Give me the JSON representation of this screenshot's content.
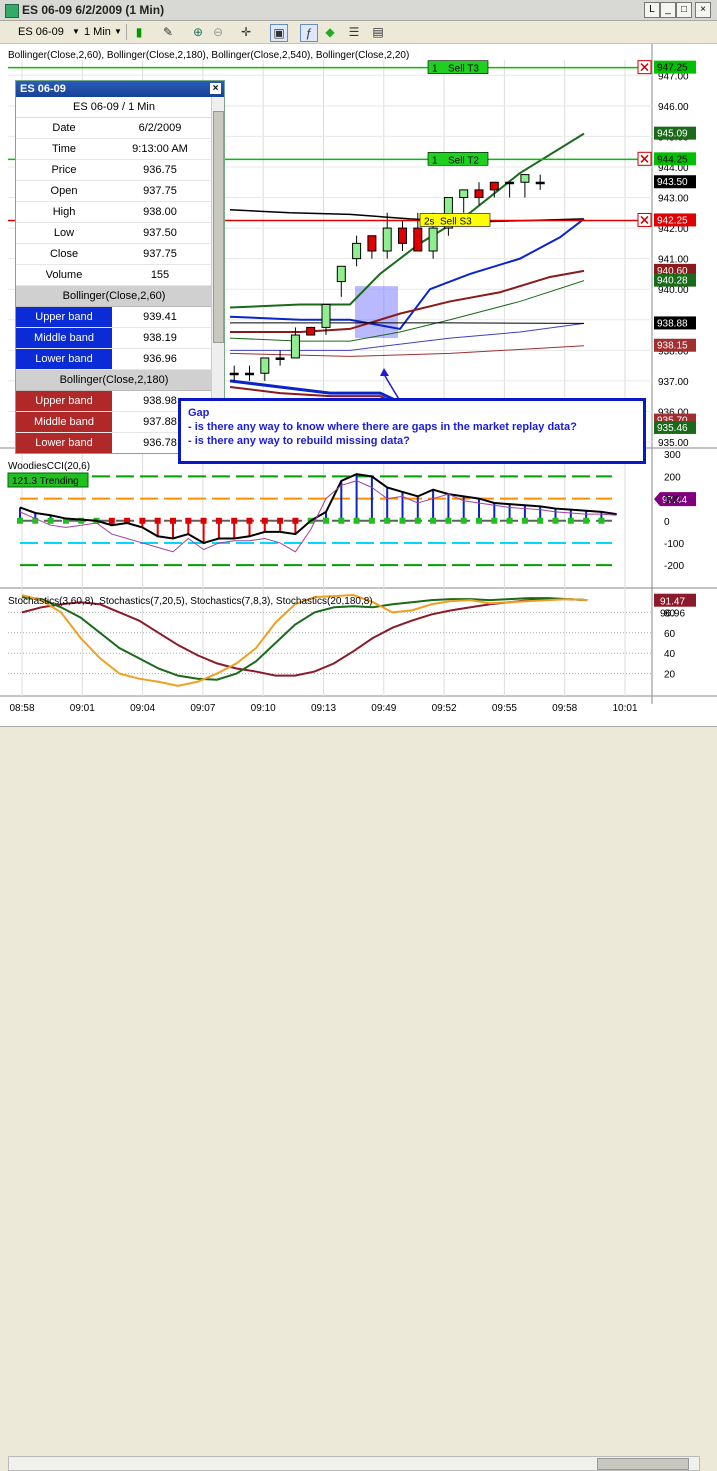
{
  "window": {
    "title": "ES 06-09  6/2/2009 (1 Min)",
    "btn_l": "L",
    "btn_min": "_",
    "btn_max": "□",
    "btn_close": "×"
  },
  "toolbar": {
    "instrument": "ES 06-09",
    "interval": "1 Min"
  },
  "indicator_labels": {
    "bollinger": "Bollinger(Close,2,60), Bollinger(Close,2,180), Bollinger(Close,2,540), Bollinger(Close,2,20)",
    "cci": "WoodiesCCI(20,6)",
    "cci_trend": "121.3 Trending",
    "stochastics": "Stochastics(3,60,8), Stochastics(7,20,5), Stochastics(7,8,3), Stochastics(20,180,8)"
  },
  "databox": {
    "title": "ES 06-09",
    "subtitle": "ES 06-09 / 1 Min",
    "rows": [
      {
        "k": "Date",
        "v": "6/2/2009"
      },
      {
        "k": "Time",
        "v": "9:13:00 AM"
      },
      {
        "k": "Price",
        "v": "936.75"
      },
      {
        "k": "Open",
        "v": "937.75"
      },
      {
        "k": "High",
        "v": "938.00"
      },
      {
        "k": "Low",
        "v": "937.50"
      },
      {
        "k": "Close",
        "v": "937.75"
      },
      {
        "k": "Volume",
        "v": "155"
      }
    ],
    "sections": [
      {
        "title": "Bollinger(Close,2,60)",
        "color": "blue",
        "rows": [
          {
            "k": "Upper band",
            "v": "939.41"
          },
          {
            "k": "Middle band",
            "v": "938.19"
          },
          {
            "k": "Lower band",
            "v": "936.96"
          }
        ]
      },
      {
        "title": "Bollinger(Close,2,180)",
        "color": "red",
        "rows": [
          {
            "k": "Upper band",
            "v": "938.98"
          },
          {
            "k": "Middle band",
            "v": "937.88"
          },
          {
            "k": "Lower band",
            "v": "936.78"
          }
        ]
      },
      {
        "title": "Bollinger(Close,2,540)",
        "color": "blue",
        "rows": []
      }
    ]
  },
  "annotation": {
    "line1": "Gap",
    "line2": "- is there any way to know where there are gaps in the market replay data?",
    "line3": "- is there any way to rebuild missing data?"
  },
  "orders": [
    {
      "qty": "1",
      "label": "Sell T3",
      "price": "947.25",
      "color": "#00c000"
    },
    {
      "qty": "1",
      "label": "Sell T2",
      "price": "944.25",
      "color": "#00c000"
    },
    {
      "qty": "2s",
      "label": "Sell S3",
      "price": "942.25",
      "color": "#e00000"
    }
  ],
  "chart_data": [
    {
      "type": "candlestick",
      "panel": "price",
      "ylim": [
        935.0,
        947.5
      ],
      "y_ticks": [
        935.0,
        936.0,
        937.0,
        938.0,
        939.0,
        940.0,
        941.0,
        942.0,
        943.0,
        944.0,
        945.0,
        946.0,
        947.0
      ],
      "x_tick_labels": [
        "08:58",
        "09:01",
        "09:04",
        "09:07",
        "09:10",
        "09:13",
        "09:49",
        "09:52",
        "09:55",
        "09:58",
        "10:01"
      ],
      "candles": [
        {
          "i": 12,
          "o": 937.25,
          "h": 937.5,
          "l": 937.0,
          "c": 937.25
        },
        {
          "i": 13,
          "o": 937.0,
          "h": 937.5,
          "l": 936.75,
          "c": 937.25
        },
        {
          "i": 14,
          "o": 937.25,
          "h": 937.5,
          "l": 937.0,
          "c": 937.25
        },
        {
          "i": 15,
          "o": 937.25,
          "h": 937.5,
          "l": 937.0,
          "c": 937.25
        },
        {
          "i": 16,
          "o": 937.25,
          "h": 937.75,
          "l": 937.0,
          "c": 937.75
        },
        {
          "i": 17,
          "o": 937.75,
          "h": 938.0,
          "l": 937.5,
          "c": 937.75
        },
        {
          "i": 18,
          "o": 937.75,
          "h": 938.75,
          "l": 937.75,
          "c": 938.5
        },
        {
          "i": 19,
          "o": 938.75,
          "h": 938.75,
          "l": 938.5,
          "c": 938.5
        },
        {
          "i": 20,
          "o": 938.75,
          "h": 939.5,
          "l": 938.5,
          "c": 939.5
        },
        {
          "i": 21,
          "o": 940.25,
          "h": 940.75,
          "l": 939.75,
          "c": 940.75
        },
        {
          "i": 22,
          "o": 941.0,
          "h": 941.75,
          "l": 940.75,
          "c": 941.5
        },
        {
          "i": 23,
          "o": 941.75,
          "h": 941.75,
          "l": 941.0,
          "c": 941.25
        },
        {
          "i": 24,
          "o": 941.25,
          "h": 942.5,
          "l": 941.0,
          "c": 942.0
        },
        {
          "i": 25,
          "o": 942.0,
          "h": 942.25,
          "l": 941.25,
          "c": 941.5
        },
        {
          "i": 26,
          "o": 942.0,
          "h": 942.5,
          "l": 941.25,
          "c": 941.25
        },
        {
          "i": 27,
          "o": 941.25,
          "h": 942.5,
          "l": 941.0,
          "c": 942.0
        },
        {
          "i": 28,
          "o": 942.0,
          "h": 943.0,
          "l": 941.75,
          "c": 943.0
        },
        {
          "i": 29,
          "o": 943.0,
          "h": 943.25,
          "l": 942.5,
          "c": 943.25
        },
        {
          "i": 30,
          "o": 943.25,
          "h": 943.5,
          "l": 942.75,
          "c": 943.0
        },
        {
          "i": 31,
          "o": 943.5,
          "h": 943.5,
          "l": 943.0,
          "c": 943.25
        },
        {
          "i": 32,
          "o": 943.5,
          "h": 943.5,
          "l": 943.0,
          "c": 943.5
        },
        {
          "i": 33,
          "o": 943.5,
          "h": 943.75,
          "l": 943.0,
          "c": 943.75
        },
        {
          "i": 34,
          "o": 943.5,
          "h": 943.75,
          "l": 943.25,
          "c": 943.5
        }
      ],
      "price_markers": [
        {
          "value": 945.09,
          "label": "945.09",
          "color": "#1a6a1a"
        },
        {
          "value": 943.5,
          "label": "943.50",
          "color": "#000000"
        },
        {
          "value": 940.6,
          "label": "940.60",
          "color": "#8b1a1a"
        },
        {
          "value": 940.28,
          "label": "940.28",
          "color": "#1a6a1a"
        },
        {
          "value": 938.88,
          "label": "938.88",
          "color": "#000000"
        },
        {
          "value": 938.15,
          "label": "938.15",
          "color": "#a03030"
        },
        {
          "value": 935.7,
          "label": "935.70",
          "color": "#a03030"
        },
        {
          "value": 935.46,
          "label": "935.46",
          "color": "#1a6a1a"
        }
      ]
    },
    {
      "type": "line",
      "panel": "cci",
      "ylim": [
        -240,
        310
      ],
      "y_ticks": [
        -200,
        -100,
        0,
        100,
        200,
        300
      ],
      "series": [
        {
          "color": "#000000",
          "values": [
            60,
            35,
            25,
            10,
            5,
            0,
            -20,
            -10,
            -30,
            -70,
            -80,
            -60,
            -100,
            -80,
            -80,
            -70,
            -50,
            -50,
            -60,
            0,
            40,
            180,
            210,
            200,
            150,
            130,
            110,
            140,
            120,
            110,
            100,
            80,
            75,
            70,
            65,
            55,
            50,
            45,
            40,
            30
          ]
        },
        {
          "color": "#a040a0",
          "values": [
            40,
            10,
            -20,
            -30,
            -20,
            -10,
            -60,
            -80,
            -100,
            -120,
            -140,
            -80,
            -130,
            -100,
            -90,
            -90,
            -80,
            -100,
            -140,
            -40,
            100,
            160,
            180,
            150,
            100,
            110,
            80,
            100,
            120,
            90,
            80,
            70,
            60,
            55,
            50,
            40,
            35,
            30,
            30,
            25
          ]
        }
      ],
      "last_value": "97.44"
    },
    {
      "type": "line",
      "panel": "stochastics",
      "ylim": [
        0,
        100
      ],
      "y_ticks": [
        20,
        40,
        60,
        80
      ],
      "series": [
        {
          "color": "#8b1a2a",
          "values": [
            80,
            85,
            88,
            90,
            88,
            80,
            72,
            60,
            48,
            38,
            30,
            25,
            22,
            18,
            18,
            22,
            30,
            42,
            55,
            65,
            72,
            78,
            82,
            85,
            88,
            90,
            92,
            93,
            93,
            92
          ]
        },
        {
          "color": "#1a6a1a",
          "values": [
            95,
            93,
            85,
            75,
            60,
            45,
            35,
            25,
            18,
            15,
            14,
            20,
            32,
            50,
            68,
            80,
            85,
            86,
            85,
            88,
            90,
            92,
            93,
            93,
            92,
            93,
            94,
            94,
            93,
            92
          ]
        },
        {
          "color": "#f0a020",
          "values": [
            97,
            92,
            80,
            55,
            35,
            20,
            15,
            12,
            8,
            12,
            20,
            30,
            45,
            70,
            88,
            95,
            96,
            97,
            90,
            80,
            82,
            88,
            91,
            92,
            89,
            90,
            91,
            92,
            93,
            92
          ]
        }
      ],
      "last_value": "91.47",
      "second_value": "96.96"
    }
  ]
}
